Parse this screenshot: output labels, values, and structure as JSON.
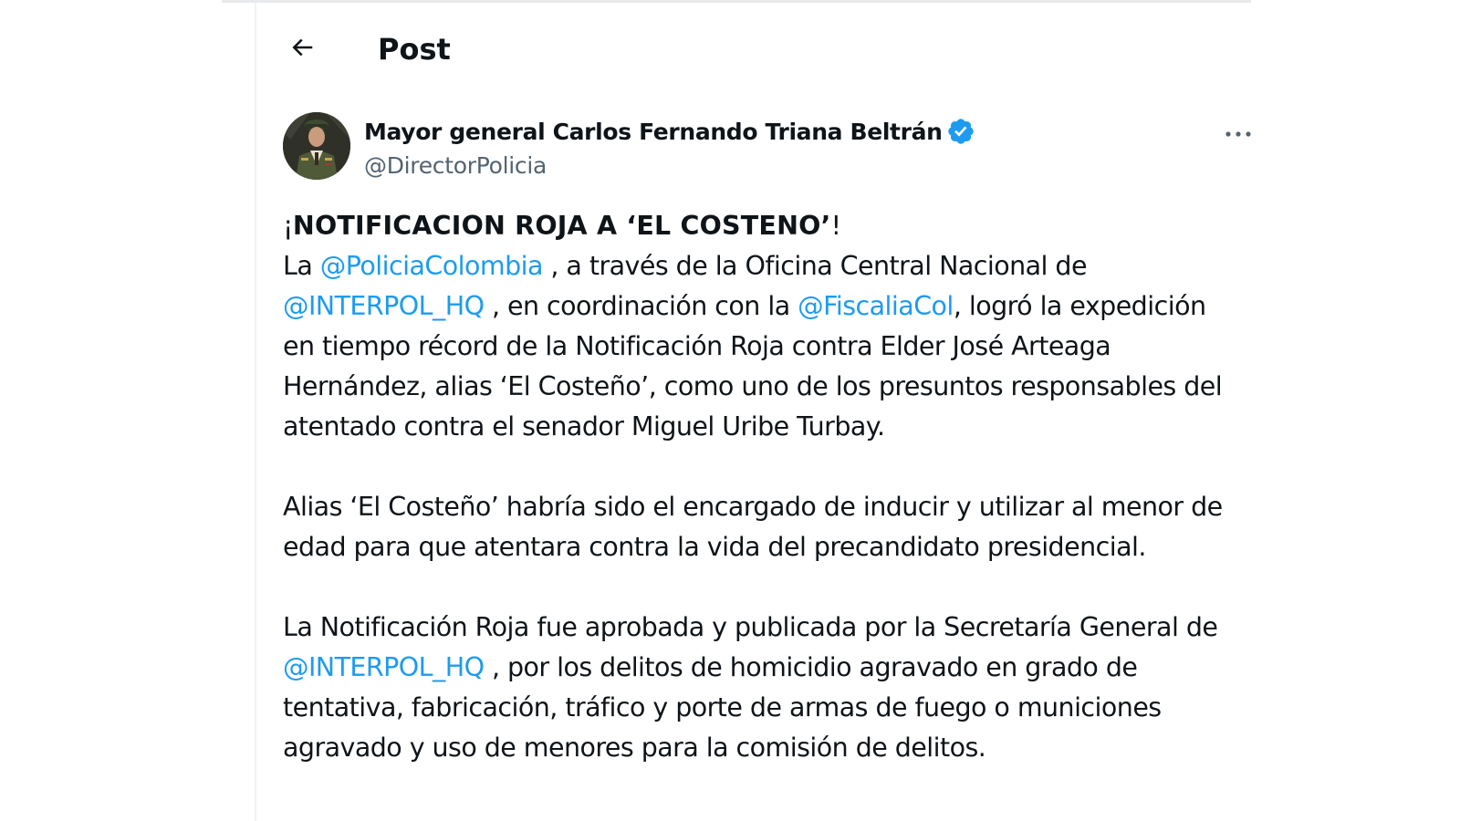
{
  "header": {
    "title": "Post",
    "back_icon": "arrow-left-icon"
  },
  "author": {
    "name": "Mayor general Carlos Fernando Triana Beltrán",
    "handle": "@DirectorPolicia",
    "verified_icon": "verified-badge-icon",
    "verified_color": "#1d9bf0",
    "more_icon": "more-horizontal-icon"
  },
  "post": {
    "headline_prefix": "¡",
    "headline": "NOTIFICACIOΝ ROJA A ‘EL COSTEΝO’",
    "headline_suffix": "!",
    "p1": {
      "l1_a": "La ",
      "mention_policia": "@PoliciaColombia",
      "l1_b": " , a través de la Oficina Central Nacional de",
      "mention_interpol": "@INTERPOL_HQ",
      "l2_a": " , en coordinación con la ",
      "mention_fiscalia": "@FiscaliaCol",
      "l2_b": ", logró la expedición",
      "l3": "en tiempo récord de la Notificación Roja contra Elder José Arteaga",
      "l4": "Hernández, alias ‘El Costeño’, como uno de los presuntos responsables del",
      "l5": "atentado contra el senador Miguel Uribe Turbay."
    },
    "p2": {
      "l1": "Alias ‘El Costeño’ habría sido el encargado de inducir y utilizar al menor de",
      "l2": "edad para que atentara contra la vida del precandidato presidencial."
    },
    "p3": {
      "l1": "La Notificación Roja fue aprobada y publicada por la Secretaría General de",
      "mention_interpol": "@INTERPOL_HQ",
      "l2_b": " , por los delitos de homicidio agravado en grado de",
      "l3": "tentativa, fabricación, tráfico y porte de armas de fuego o municiones",
      "l4": "agravado y uso de menores para la comisión de delitos."
    }
  },
  "colors": {
    "text": "#0f1419",
    "secondary": "#536471",
    "link": "#1d9bf0",
    "border": "#eff3f4"
  }
}
